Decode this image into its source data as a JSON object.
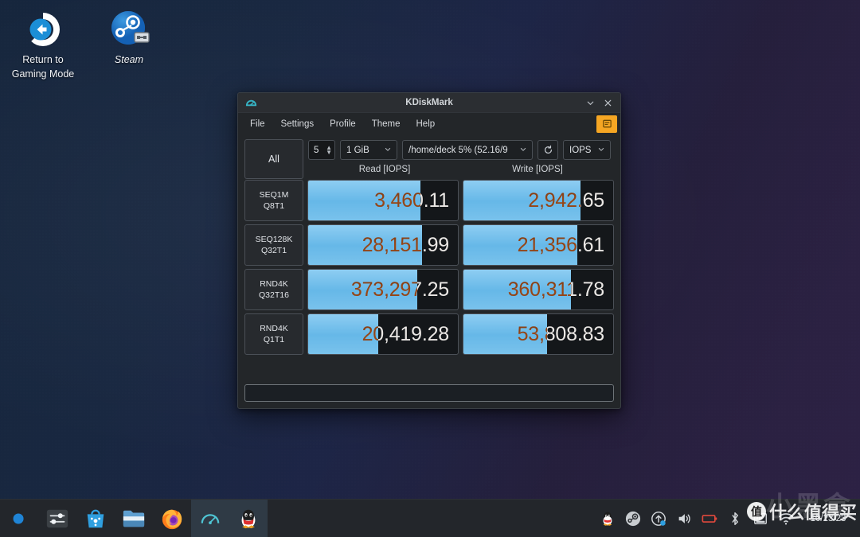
{
  "desktop": {
    "icons": [
      {
        "name": "return-to-gaming-mode",
        "label": "Return to\nGaming Mode",
        "label_line1": "Return to",
        "label_line2": "Gaming Mode"
      },
      {
        "name": "steam",
        "label": "Steam",
        "label_line1": "Steam",
        "label_line2": ""
      }
    ]
  },
  "window": {
    "title": "KDiskMark",
    "app_icon": "speedometer-icon",
    "titlebar_buttons": [
      {
        "name": "minimize-button",
        "glyph": "∨"
      },
      {
        "name": "close-button",
        "glyph": "✕"
      }
    ],
    "menu": [
      {
        "label": "File"
      },
      {
        "label": "Settings"
      },
      {
        "label": "Profile"
      },
      {
        "label": "Theme"
      },
      {
        "label": "Help"
      }
    ],
    "donate_button": {
      "name": "donate-button",
      "icon": "donate-icon",
      "color": "#f5a623"
    },
    "toolbar": {
      "all_label": "All",
      "loops_value": "5",
      "size_value": "1 GiB",
      "path_value": "/home/deck 5% (52.16/9",
      "refresh_icon": "refresh-icon",
      "unit_value": "IOPS"
    },
    "columns": [
      {
        "label": "Read [IOPS]"
      },
      {
        "label": "Write [IOPS]"
      }
    ],
    "rows": [
      {
        "label_line1": "SEQ1M",
        "label_line2": "Q8T1",
        "read": "3,460.11",
        "read_fill": 75,
        "write": "2,942.65",
        "write_fill": 78
      },
      {
        "label_line1": "SEQ128K",
        "label_line2": "Q32T1",
        "read": "28,151.99",
        "read_fill": 76,
        "write": "21,356.61",
        "write_fill": 76
      },
      {
        "label_line1": "RND4K",
        "label_line2": "Q32T16",
        "read": "373,297.25",
        "read_fill": 73,
        "write": "360,311.78",
        "write_fill": 72
      },
      {
        "label_line1": "RND4K",
        "label_line2": "Q1T1",
        "read": "20,419.28",
        "read_fill": 47,
        "write": "53,808.83",
        "write_fill": 56
      }
    ],
    "status_text": ""
  },
  "taskbar": {
    "launchers": [
      {
        "name": "application-launcher-icon",
        "active": false
      },
      {
        "name": "settings-icon",
        "active": false
      },
      {
        "name": "discover-software-icon",
        "active": false
      },
      {
        "name": "file-manager-icon",
        "active": false
      },
      {
        "name": "firefox-icon",
        "active": false
      },
      {
        "name": "kdiskmark-icon",
        "active": true
      },
      {
        "name": "qq-penguin-icon",
        "active": true
      }
    ],
    "tray": [
      {
        "name": "qq-penguin-tray-icon"
      },
      {
        "name": "steam-tray-icon"
      },
      {
        "name": "updates-icon"
      },
      {
        "name": "volume-icon"
      },
      {
        "name": "battery-icon",
        "color": "#e0483c"
      },
      {
        "name": "bluetooth-icon"
      },
      {
        "name": "disk-icon"
      },
      {
        "name": "wifi-icon"
      }
    ],
    "clock": "10/23/23"
  },
  "watermark": {
    "badge": "值",
    "text": "什么值得买",
    "ghost": "小黑盒"
  },
  "colors": {
    "accent_blue": "#6fbce9",
    "window_bg": "#232629",
    "donate_orange": "#f5a623",
    "battery_red": "#e0483c"
  }
}
